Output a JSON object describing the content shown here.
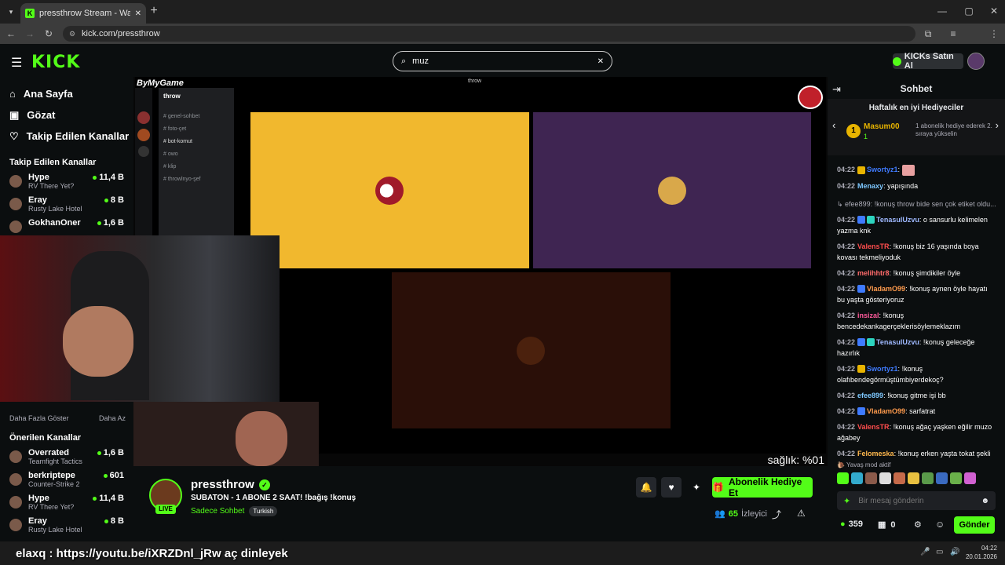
{
  "browser": {
    "tab_title": "pressthrow Stream - Watch Liv",
    "url": "kick.com/pressthrow"
  },
  "header": {
    "logo": "KICK",
    "search_value": "muz",
    "kicks_label": "KICKs Satın Al"
  },
  "sidebar": {
    "nav": [
      {
        "label": "Ana Sayfa"
      },
      {
        "label": "Gözat"
      },
      {
        "label": "Takip Edilen Kanallar"
      }
    ],
    "followed_title": "Takip Edilen Kanallar",
    "followed": [
      {
        "name": "Hype",
        "game": "RV There Yet?",
        "viewers": "11,4 B"
      },
      {
        "name": "Eray",
        "game": "Rusty Lake Hotel",
        "viewers": "8 B"
      },
      {
        "name": "GokhanOner",
        "game": "",
        "viewers": "1,6 B"
      }
    ],
    "show_more": "Daha Fazla Göster",
    "show_less": "Daha Az",
    "recommended_title": "Önerilen Kanallar",
    "recommended": [
      {
        "name": "Overrated",
        "game": "Teamfight Tactics",
        "viewers": "1,6 B"
      },
      {
        "name": "berkriptepe",
        "game": "Counter-Strike 2",
        "viewers": "601"
      },
      {
        "name": "Hype",
        "game": "RV There Yet?",
        "viewers": "11,4 B"
      },
      {
        "name": "Eray",
        "game": "Rusty Lake Hotel",
        "viewers": "8 B"
      }
    ]
  },
  "video": {
    "discord_server": "throw",
    "discord_title": "throw",
    "overlay_brand": "ByMyGame",
    "channels": [
      "genel-sohbet",
      "foto-çet",
      "bot-komut",
      "owo",
      "klip",
      "throwlnyo-şef"
    ],
    "health_text": "sağlık: %01"
  },
  "stream": {
    "channel": "pressthrow",
    "title": "SUBATON - 1 ABONE 2 SAAT! !bağış !konuş",
    "chat_mode": "Sadece Sohbet",
    "language": "Turkish",
    "live": "LIVE",
    "gift_button": "Abonelik Hediye Et",
    "viewers": "65",
    "viewers_label": "İzleyici"
  },
  "chat": {
    "title": "Sohbet",
    "gifters_title": "Haftalık en iyi Hediyeciler",
    "top_gifter": "Masum00",
    "top_gifter_count": "1",
    "gifter_hint": "1 abonelik hediye ederek 2. sıraya yükselin",
    "messages": [
      {
        "time": "04:22",
        "user": "Swortyz1",
        "color": "#3f7bff",
        "text": ""
      },
      {
        "time": "04:22",
        "user": "Menaxy",
        "color": "#7ec8ff",
        "text": "yapışında"
      },
      {
        "time": "",
        "user": "",
        "color": "#adadb8",
        "text": "efee899: !konuş throw bide sen çok etiket oldu..."
      },
      {
        "time": "04:22",
        "user": "TenasulUzvu",
        "color": "#9fb9ff",
        "text": "o sansurlu kelimelen yazma knk"
      },
      {
        "time": "04:22",
        "user": "ValensTR",
        "color": "#ff4d4d",
        "text": "!konuş biz 16 yaşında boya kovası tekmeliyoduk"
      },
      {
        "time": "04:22",
        "user": "melihhtr8",
        "color": "#ff6b6b",
        "text": "!konuş şimdikiler öyle"
      },
      {
        "time": "04:22",
        "user": "VladamO99",
        "color": "#ff9b4d",
        "text": "!konuş aynen öyle hayatı bu yaşta gösteriyoruz"
      },
      {
        "time": "04:22",
        "user": "insizal",
        "color": "#ff5a9b",
        "text": "!konuş bencedekankagerçeklerisöylemeklazım"
      },
      {
        "time": "04:22",
        "user": "TenasulUzvu",
        "color": "#9fb9ff",
        "text": "!konuş geleceğe hazırlık"
      },
      {
        "time": "04:22",
        "user": "Swortyz1",
        "color": "#3f7bff",
        "text": "!konuş olafıbendegörmüştümbiyerdekoç?"
      },
      {
        "time": "04:22",
        "user": "efee899",
        "color": "#7ec8ff",
        "text": "!konuş gitme işi bb"
      },
      {
        "time": "04:22",
        "user": "VladamO99",
        "color": "#ff9b4d",
        "text": "sarfatrat"
      },
      {
        "time": "04:22",
        "user": "ValensTR",
        "color": "#ff4d4d",
        "text": "!konuş ağaç yaşken eğilir muzo ağabey"
      },
      {
        "time": "04:22",
        "user": "Felomeska",
        "color": "#ffb84d",
        "text": "!konuş erken yaşta tokat şekli"
      }
    ],
    "slow_mode": "Yavaş mod aktif",
    "input_placeholder": "Bir mesaj gönderin",
    "points": "359",
    "count2": "0",
    "send_label": "Gönder"
  },
  "taskbar": {
    "ticker": "elaxq : https://youtu.be/iXRZDnl_jRw aç dinleyek",
    "time": "04:22",
    "date": "20.01.2026"
  },
  "colors": {
    "accent": "#53fc18",
    "bg": "#0b0e0f"
  }
}
